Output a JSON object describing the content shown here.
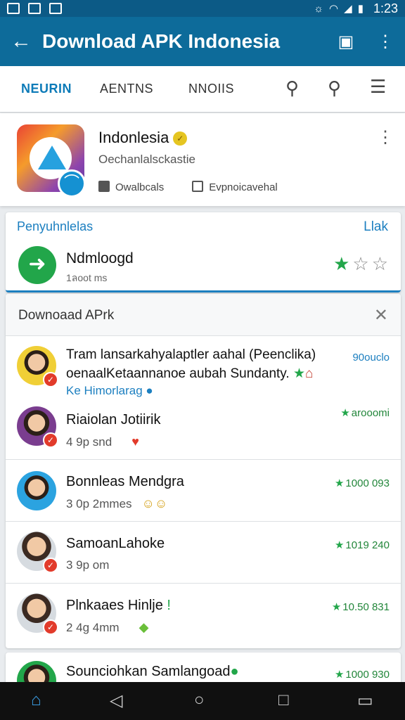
{
  "status_bar": {
    "time": "1:23"
  },
  "app_bar": {
    "title": "Download APK Indonesia"
  },
  "tabs": [
    "NEURIN",
    "AENTNS",
    "NNOIIS"
  ],
  "app": {
    "name": "Indonlesia",
    "subtitle": "Oechanlalsckastie",
    "meta": [
      "Owalbcals",
      "Evpnoicavehal"
    ]
  },
  "featured": {
    "header_left": "Penyuhnlelas",
    "header_right": "Llak",
    "title": "Ndmloogd",
    "subtitle": "1ลoot ms"
  },
  "list": {
    "header": "Downoaad APrk",
    "items": [
      {
        "name": "Tram lansarkahyalaptler aahal (Peenclika)",
        "line2": "oenaalKetaannanoe aubah Sundanty.",
        "line3": "Ke Himorlarag",
        "value": "90ouclo"
      },
      {
        "name": "Riaiolan Jotiirik",
        "sub": "4 9p snd",
        "value": "arooomi"
      },
      {
        "name": "Bonnleas Mendgra",
        "sub": "3 0p 2mmes",
        "value": "1000 093"
      },
      {
        "name": "SamoanLahoke",
        "sub": "3 9p om",
        "value": "1019 240"
      },
      {
        "name": "Plnkaaes Hinlje",
        "sub": "2 4g 4mm",
        "value": "10.50 831"
      },
      {
        "name": "Sounciohkan Samlangoad",
        "value": "1000 930"
      }
    ]
  },
  "colors": {
    "primary": "#0d6b9a",
    "accent": "#1c7fc0",
    "green": "#22a64a"
  }
}
